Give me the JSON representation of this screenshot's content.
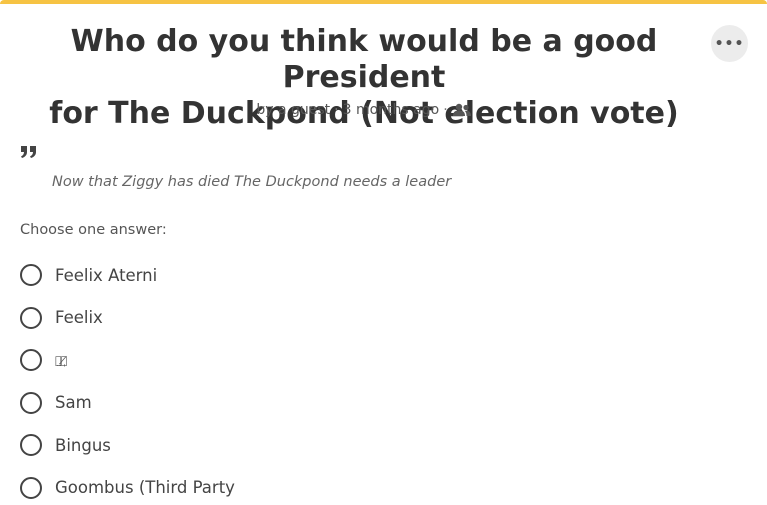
{
  "poll": {
    "title_line1": "Who do you think would be a good President",
    "title_line2": "for The Duckpond (Not election vote)",
    "author": "by a guest",
    "time_ago": "3 months ago",
    "separator": "·",
    "audience_icon": "users-icon",
    "more_icon": "ellipsis-icon",
    "more_label": "•••",
    "description": "Now that Ziggy has died The Duckpond needs a leader",
    "prompt": "Choose one answer:",
    "options": [
      {
        "label": "Feelix Aterni"
      },
      {
        "label": "Feelix"
      },
      {
        "label": "ﾐ̤ﾐ̸̩"
      },
      {
        "label": "Sam"
      },
      {
        "label": "Bingus"
      },
      {
        "label": "Goombus (Third Party"
      }
    ]
  },
  "colors": {
    "accent_top_border": "#f6c343",
    "title_text": "#333333",
    "muted_text": "#555555",
    "button_bg": "#ececec"
  }
}
